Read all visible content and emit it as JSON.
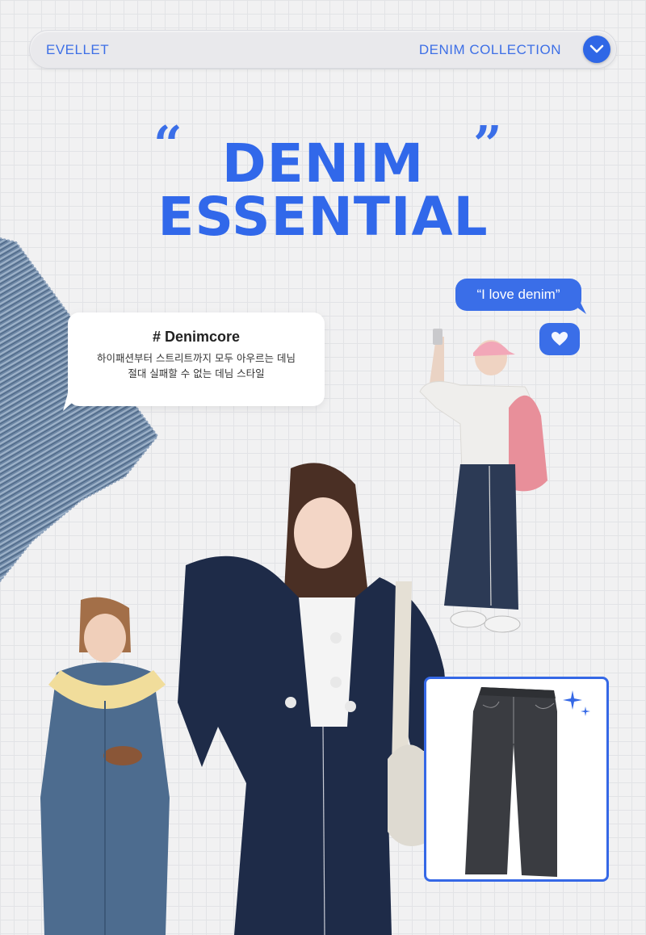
{
  "nav": {
    "brand": "EVELLET",
    "collection": "DENIM COLLECTION",
    "toggle_icon": "chevron-down-icon"
  },
  "headline": {
    "line1": "DENIM",
    "line2": "ESSENTIAL",
    "open_quote": "“",
    "close_quote": "”"
  },
  "hashtag_bubble": {
    "title": "# Denimcore",
    "line1": "하이패션부터 스트리트까지 모두 아우르는 데님",
    "line2": "절대 실패할 수 없는 데님 스타일"
  },
  "chat": {
    "message": "“I love denim”",
    "reaction_icon": "heart-icon"
  },
  "colors": {
    "accent": "#3168ea",
    "background": "#f1f1f2",
    "grid": "#e2e3e6"
  }
}
